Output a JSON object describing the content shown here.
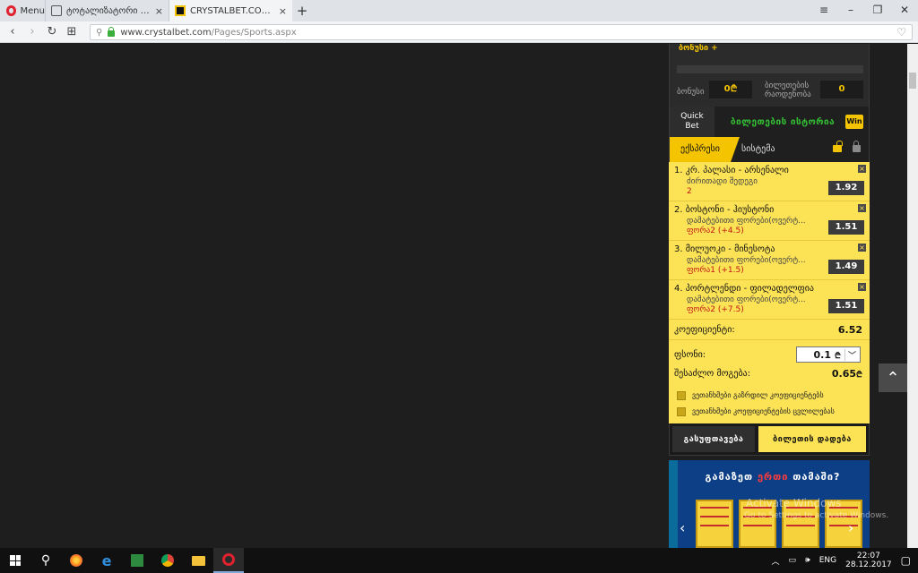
{
  "browser": {
    "menu_label": "Menu",
    "tabs": [
      {
        "title": "ტოტალიზატორი -> თბ..."
      },
      {
        "title": "CRYSTALBET.COM - თნლაინ..."
      }
    ],
    "new_tab": "+",
    "url_domain": "www.crystalbet.com",
    "url_path": "/Pages/Sports.aspx"
  },
  "account": {
    "cut_label": "ბონუსი +",
    "bonus_label": "ბონუსი",
    "bonus_value": "0",
    "tickets_label_1": "ბილეთების",
    "tickets_label_2": "რაოდენობა",
    "tickets_value": "0"
  },
  "tabs_top": {
    "quick_bet_1": "Quick",
    "quick_bet_2": "Bet",
    "history": "ბილეთების ისტორია",
    "win_badge": "Win"
  },
  "tabs_bet": {
    "express": "ექსპრესი",
    "system": "სისტემა"
  },
  "bets": [
    {
      "title": "1. კრ. პალასი - არსენალი",
      "market": "ძირითადი შედეგი",
      "selection": "2",
      "odd": "1.92"
    },
    {
      "title": "2. ბოსტონი - ჰიუსტონი",
      "market": "დამატებითი ფორები(ოვერტ...",
      "selection": "ფორა2 (+4.5)",
      "odd": "1.51"
    },
    {
      "title": "3. მილუოკი - მინესოტა",
      "market": "დამატებითი ფორები(ოვერტ...",
      "selection": "ფორა1 (+1.5)",
      "odd": "1.49"
    },
    {
      "title": "4. პორტლენდი - ფილადელფია",
      "market": "დამატებითი ფორები(ოვერტ...",
      "selection": "ფორა2 (+7.5)",
      "odd": "1.51"
    }
  ],
  "slip": {
    "coef_label": "კოეფიციენტი:",
    "coef_value": "6.52",
    "stake_label": "ფსონი:",
    "stake_value": "0.1",
    "win_label": "შესაძლო მოგება:",
    "win_value": "0.65",
    "accept_higher": "ვეთანხმები გაზრდილ კოეფიციენტებს",
    "accept_changes": "ვეთანხმები კოეფიციენტების ცვლილებას",
    "clear_btn": "გასუფთავება",
    "place_btn": "ბილეთის დადება",
    "currency_symbol": "₾"
  },
  "banner": {
    "headline_a": "გამაზეთ ",
    "headline_b": "ერთი",
    "headline_c": " თამაში?"
  },
  "watermark": {
    "line1": "Activate Windows",
    "line2": "Go to Settings to activate Windows."
  },
  "tray": {
    "lang": "ENG",
    "time": "22:07",
    "date": "28.12.2017"
  }
}
